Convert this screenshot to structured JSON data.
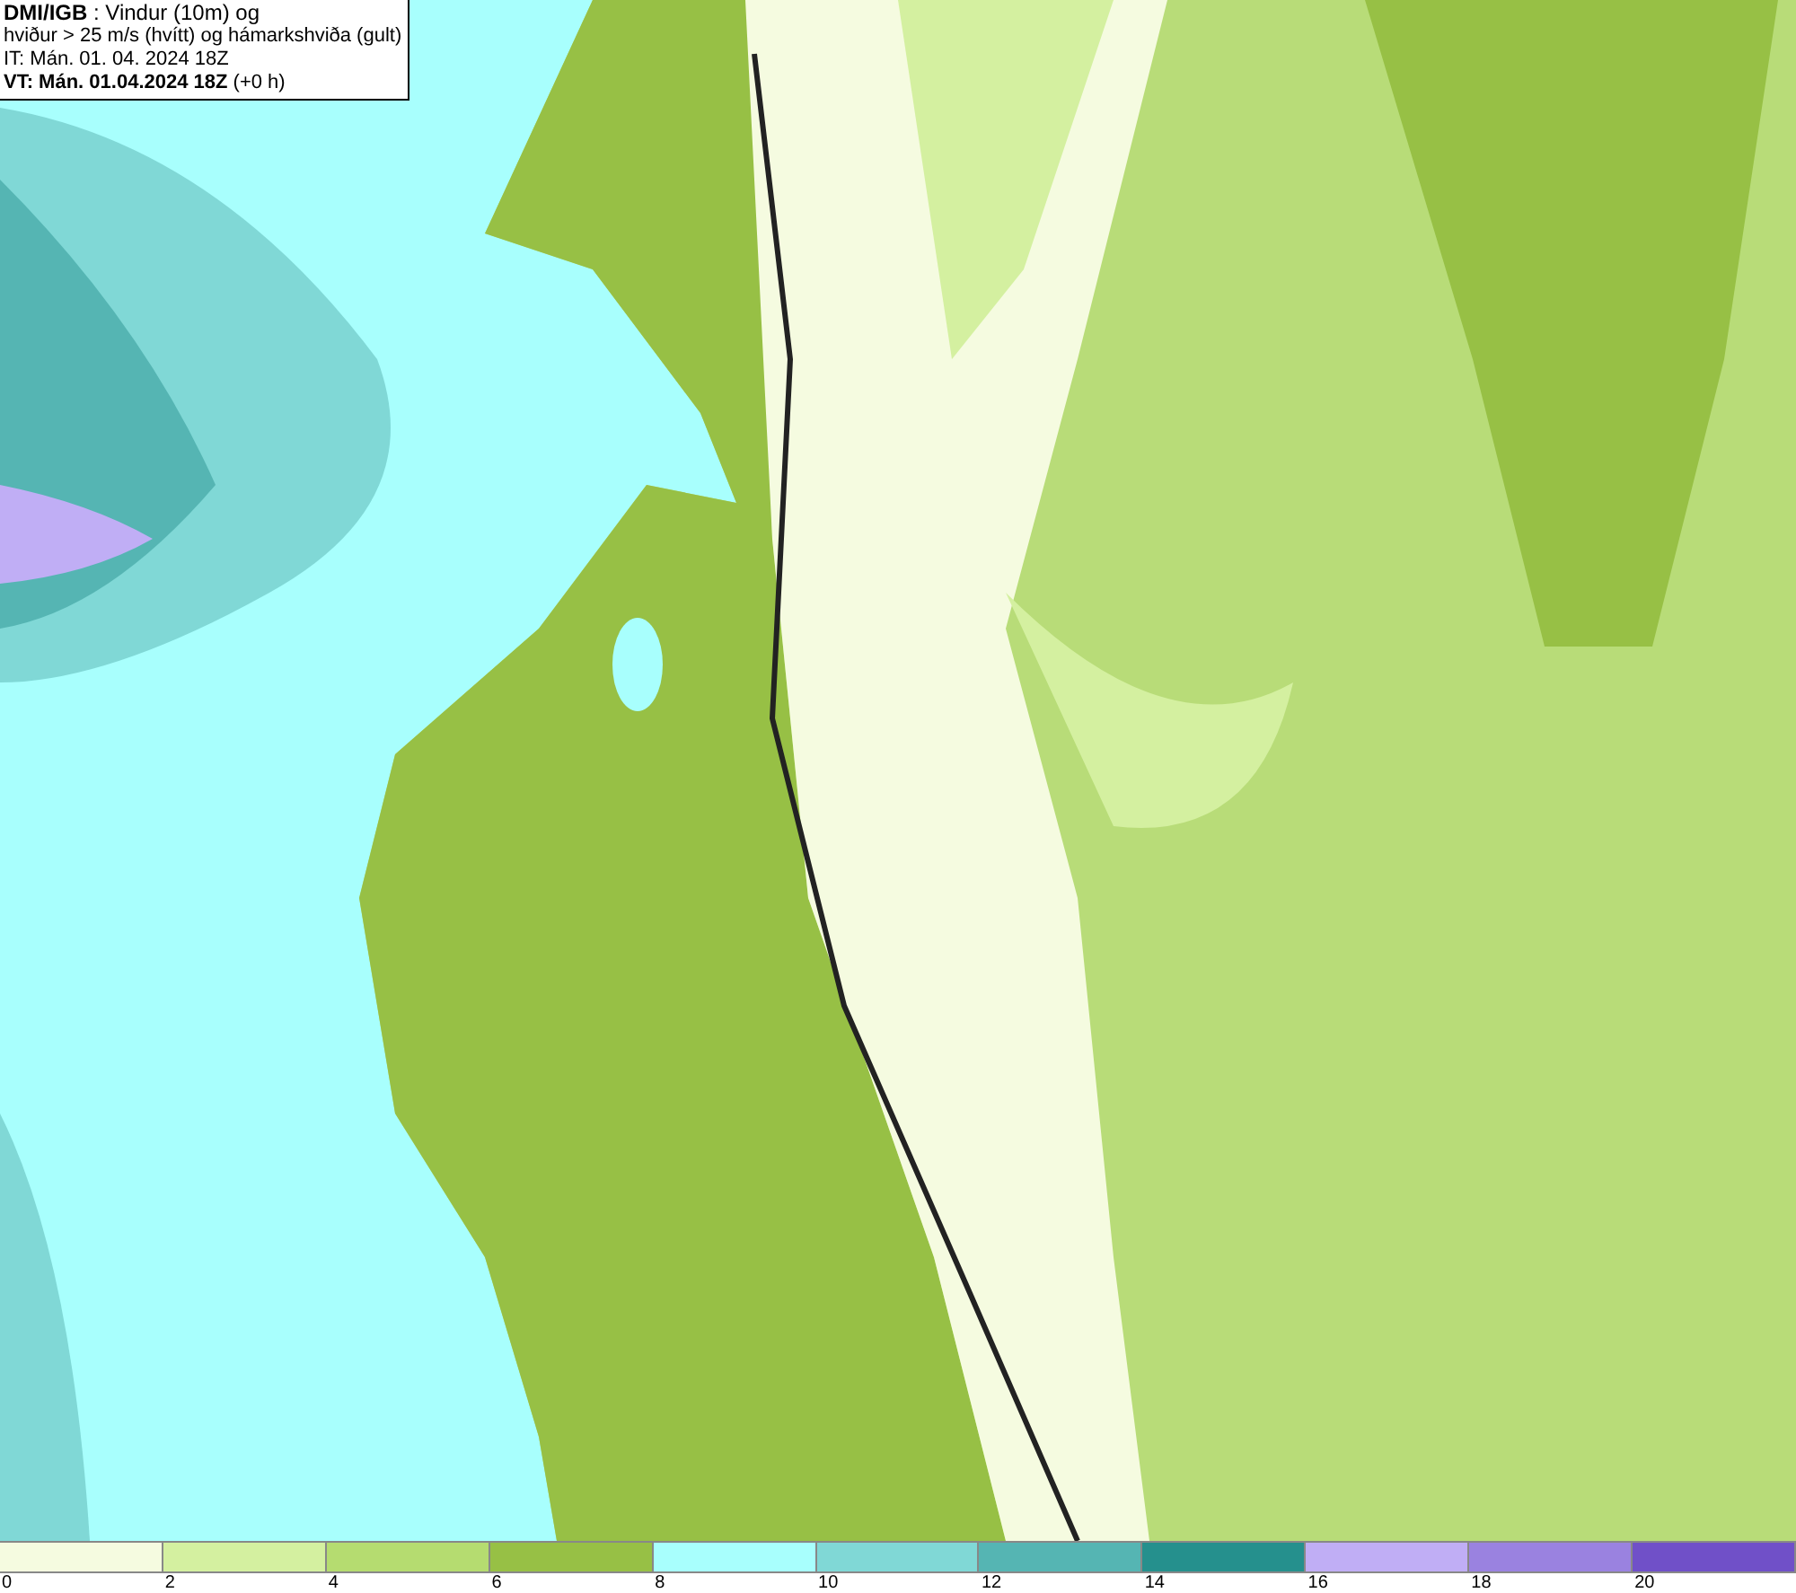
{
  "header": {
    "lines": [
      "**DMI/IGB** : Vindur (10m) og",
      "hviður > 25 m/s (hvítt) og hámarkshviða (gult)",
      "IT: Mán. 01. 04. 2024 18Z",
      "**VT: Mán. 01.04.2024 18Z** (+0 h)"
    ]
  },
  "legend": {
    "swatches": [
      {
        "color": "#f5fbe0"
      },
      {
        "color": "#d4f0a0"
      },
      {
        "color": "#b5dc70"
      },
      {
        "color": "#97c045"
      },
      {
        "color": "#a8fffd"
      },
      {
        "color": "#80d8d6"
      },
      {
        "color": "#55b5b3"
      },
      {
        "color": "#25908d"
      },
      {
        "color": "#c0aef5"
      },
      {
        "color": "#9a82e0"
      },
      {
        "color": "#7050c8"
      }
    ],
    "labels": [
      "0",
      "2",
      "4",
      "6",
      "8",
      "10",
      "12",
      "14",
      "16",
      "18",
      "20"
    ]
  }
}
